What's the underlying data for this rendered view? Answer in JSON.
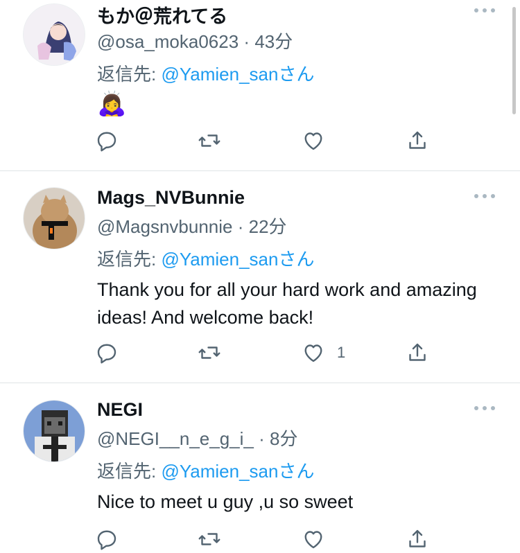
{
  "tweets": [
    {
      "name": "もか＠荒れてる",
      "handle": "@osa_moka0623",
      "time": "43分",
      "reply_prefix": "返信先: ",
      "reply_to": "@Yamien_san",
      "reply_suffix": "さん",
      "text": "🙇‍♀️",
      "likes": ""
    },
    {
      "name": "Mags_NVBunnie",
      "handle": "@Magsnvbunnie",
      "time": "22分",
      "reply_prefix": "返信先: ",
      "reply_to": "@Yamien_san",
      "reply_suffix": "さん",
      "text": "Thank you for all your hard work and amazing ideas! And welcome back!",
      "likes": "1"
    },
    {
      "name": "NEGI",
      "handle": "@NEGI__n_e_g_i_",
      "time": "8分",
      "reply_prefix": "返信先: ",
      "reply_to": "@Yamien_san",
      "reply_suffix": "さん",
      "text": "Nice to meet u guy ,u so sweet",
      "likes": ""
    }
  ],
  "separator": " · ",
  "icons": [
    "reply-icon",
    "retweet-icon",
    "like-icon",
    "share-icon",
    "more-icon"
  ],
  "colors": {
    "link": "#1d9bf0",
    "secondary": "#536471",
    "primary": "#0f1419"
  }
}
